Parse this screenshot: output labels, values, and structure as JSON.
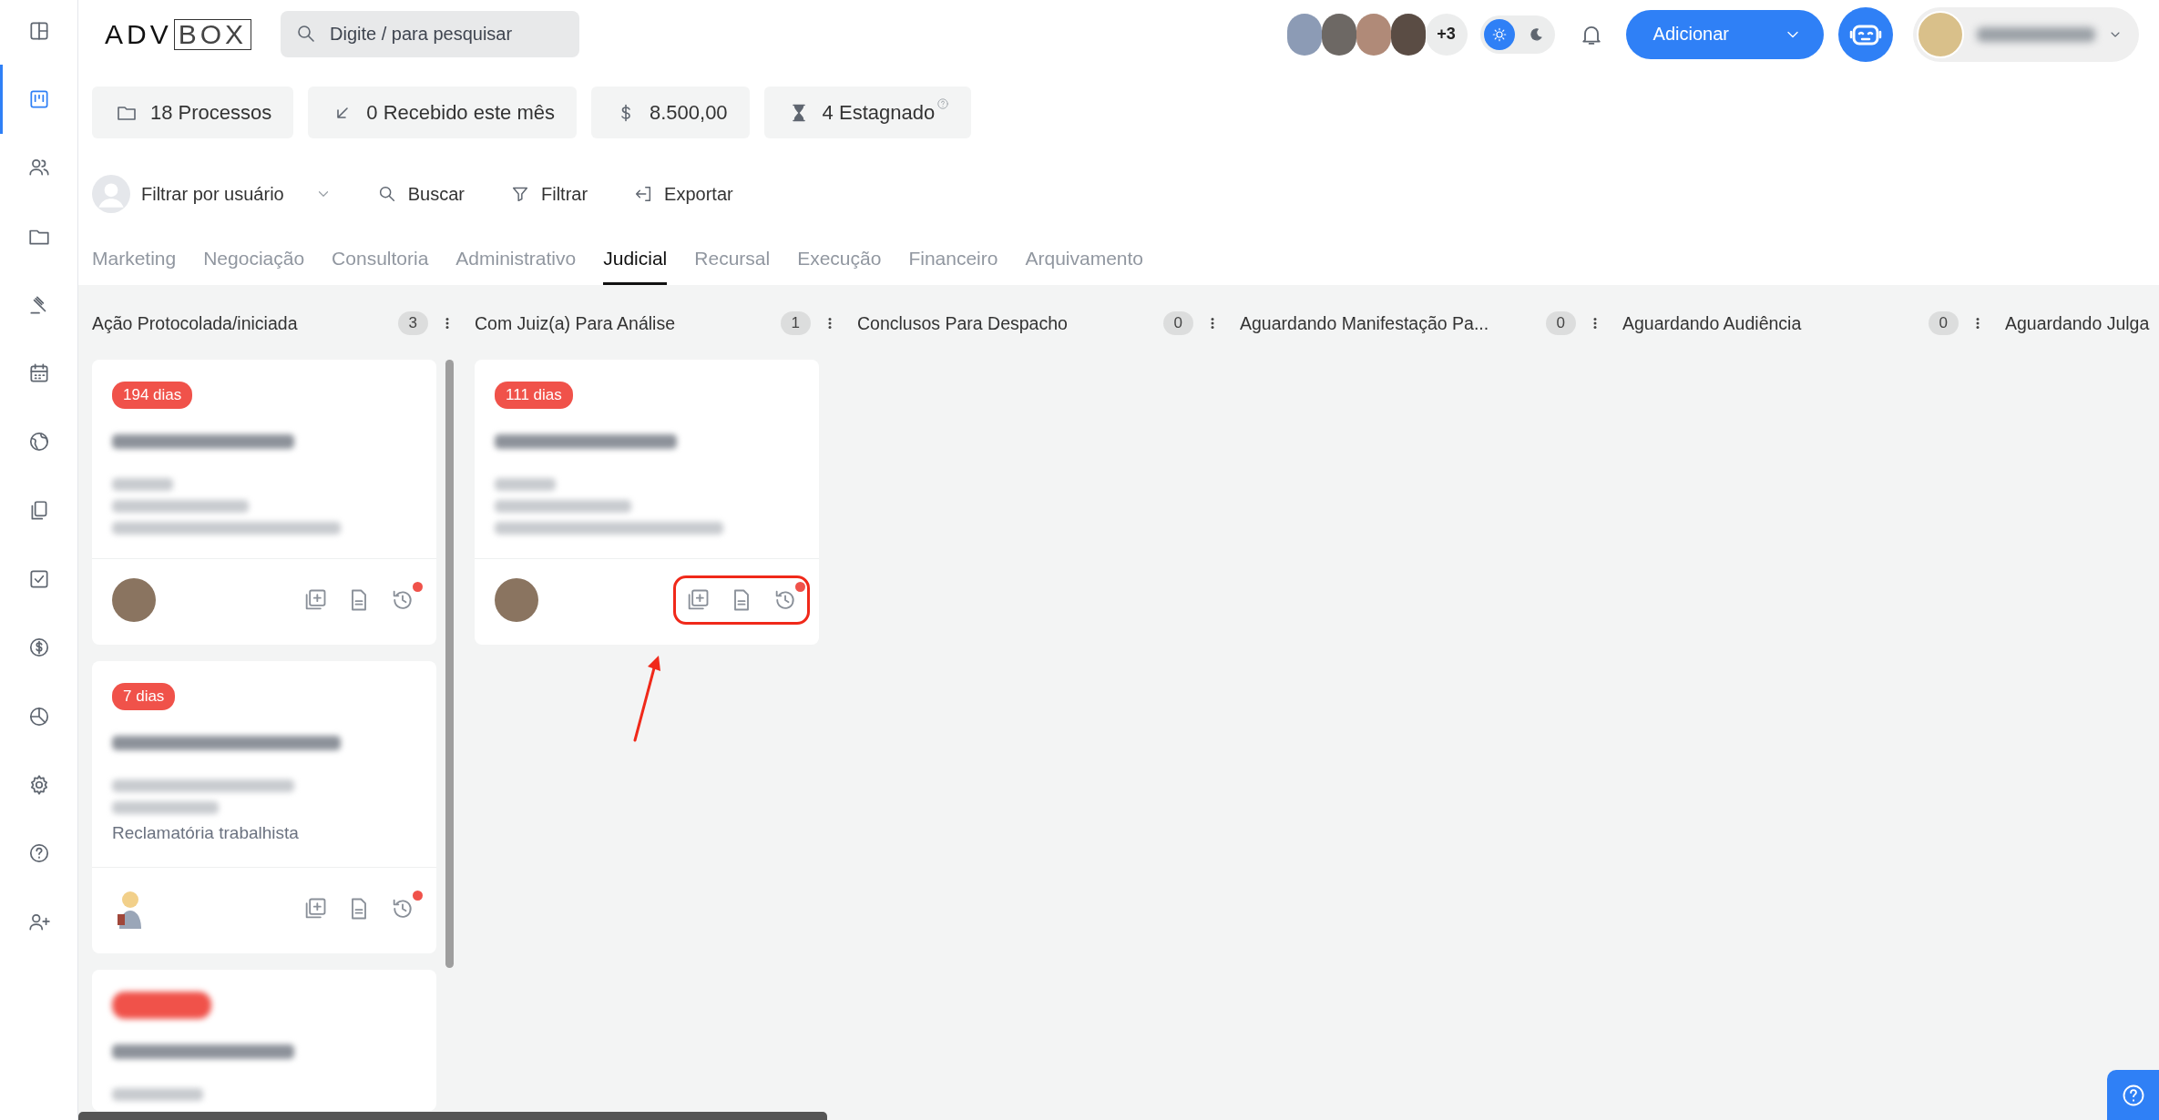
{
  "sidebar": [
    {
      "kind": "layout",
      "selected": false
    },
    {
      "kind": "kanban",
      "selected": true
    },
    {
      "kind": "users",
      "selected": false
    },
    {
      "kind": "folder",
      "selected": false
    },
    {
      "kind": "gavel",
      "selected": false
    },
    {
      "kind": "calendar",
      "selected": false
    },
    {
      "kind": "globe",
      "selected": false
    },
    {
      "kind": "files",
      "selected": false
    },
    {
      "kind": "checkbox",
      "selected": false
    },
    {
      "kind": "dollar",
      "selected": false
    },
    {
      "kind": "pie",
      "selected": false
    },
    {
      "kind": "gear",
      "selected": false
    },
    {
      "kind": "help",
      "selected": false
    },
    {
      "kind": "user-plus",
      "selected": false
    }
  ],
  "header": {
    "logo": {
      "plain": "ADV",
      "boxed": "BOX"
    },
    "search": {
      "placeholder": "Digite / para pesquisar"
    },
    "team_more": "+3",
    "dark_mode": false,
    "add_button": "Adicionar"
  },
  "stats": [
    {
      "kind": "folder",
      "text": "18 Processos",
      "help": false
    },
    {
      "kind": "received",
      "text": "0 Recebido este mês",
      "help": false
    },
    {
      "kind": "dollar",
      "text": "8.500,00",
      "help": false
    },
    {
      "kind": "hourglass",
      "text": "4 Estagnado",
      "help": true
    }
  ],
  "toolbar": {
    "user_filter": "Filtrar por usuário",
    "actions": [
      {
        "kind": "search",
        "label": "Buscar"
      },
      {
        "kind": "filter",
        "label": "Filtrar"
      },
      {
        "kind": "export",
        "label": "Exportar"
      }
    ]
  },
  "tabs": [
    {
      "label": "Marketing",
      "selected": false
    },
    {
      "label": "Negociação",
      "selected": false
    },
    {
      "label": "Consultoria",
      "selected": false
    },
    {
      "label": "Administrativo",
      "selected": false
    },
    {
      "label": "Judicial",
      "selected": true
    },
    {
      "label": "Recursal",
      "selected": false
    },
    {
      "label": "Execução",
      "selected": false
    },
    {
      "label": "Financeiro",
      "selected": false
    },
    {
      "label": "Arquivamento",
      "selected": false
    }
  ],
  "columns": [
    {
      "title": "Ação Protocolada/iniciada",
      "count": "3",
      "cards": [
        {
          "badge": "194 dias",
          "kind": "photo",
          "notification": true,
          "highlighted": false
        },
        {
          "badge": "7 dias",
          "detail": "Reclamatória trabalhista",
          "kind": "cartoon",
          "notification": true,
          "highlighted": false
        },
        {
          "kind": "partial"
        }
      ]
    },
    {
      "title": "Com Juiz(a) Para Análise",
      "count": "1",
      "cards": [
        {
          "badge": "111 dias",
          "kind": "photo",
          "notification": true,
          "highlighted": true
        }
      ]
    },
    {
      "title": "Conclusos Para Despacho",
      "count": "0"
    },
    {
      "title": "Aguardando Manifestação Pa...",
      "count": "0"
    },
    {
      "title": "Aguardando Audiência",
      "count": "0"
    },
    {
      "title": "Aguardando Julga"
    }
  ]
}
